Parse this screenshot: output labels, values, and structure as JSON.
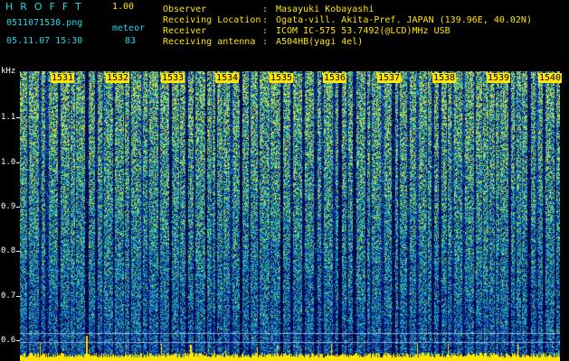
{
  "header": {
    "app_name": "HROFFT",
    "version": "1.00",
    "filename": "0511071530.png",
    "mode_label": "meteor",
    "datetime": "05.11.07 15:30",
    "meteor_count": "83"
  },
  "info": [
    {
      "label": "Observer",
      "sep": ":",
      "value": "Masayuki Kobayashi"
    },
    {
      "label": "Receiving Location",
      "sep": ":",
      "value": "Ogata-vill. Akita-Pref. JAPAN (139.96E, 40.02N)"
    },
    {
      "label": "Receiver",
      "sep": ":",
      "value": "ICOM IC-575 53.7492(@LCD)MHz USB"
    },
    {
      "label": "Receiving antenna",
      "sep": ":",
      "value": "A504HB(yagi 4el)"
    }
  ],
  "spectrogram": {
    "y_unit": "kHz",
    "y_ticks": [
      "1.1",
      "1.0",
      "0.9",
      "0.8",
      "0.7",
      "0.6"
    ],
    "minute_labels": [
      "1531",
      "1532",
      "1533",
      "1534",
      "1535",
      "1536",
      "1537",
      "1538",
      "1539",
      "1540"
    ],
    "colors": {
      "background": "#000000",
      "accent": "#ffe600",
      "text_cyan": "#22d8e8",
      "text_green": "#39e860"
    }
  }
}
